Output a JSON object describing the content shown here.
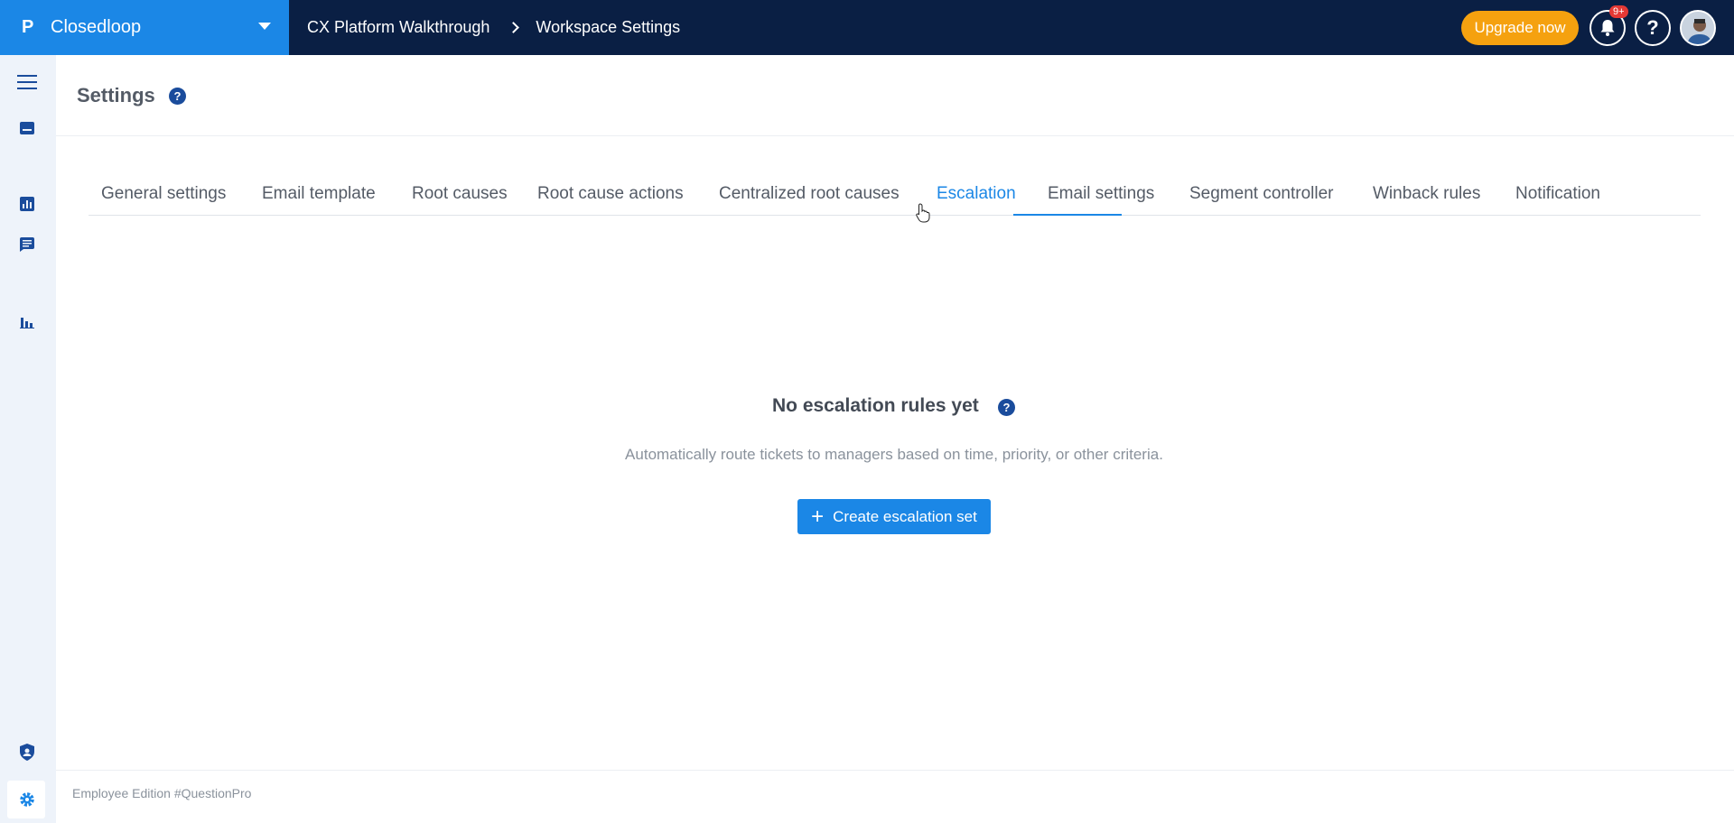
{
  "header": {
    "brand_logo": "P",
    "brand_name": "Closedloop",
    "breadcrumbs": [
      "CX Platform Walkthrough",
      "Workspace Settings"
    ],
    "upgrade_label": "Upgrade now",
    "notification_badge": "9+",
    "help_label": "?"
  },
  "sidebar": {
    "icons": [
      "menu-icon",
      "inbox-icon",
      "report-icon",
      "chat-icon",
      "bar-chart-icon",
      "admin-shield-icon",
      "settings-gear-icon"
    ]
  },
  "page": {
    "title": "Settings",
    "help": "?"
  },
  "tabs": [
    {
      "label": "General settings"
    },
    {
      "label": "Email template"
    },
    {
      "label": "Root causes"
    },
    {
      "label": "Root cause actions"
    },
    {
      "label": "Centralized root causes"
    },
    {
      "label": "Escalation",
      "active": true
    },
    {
      "label": "Email settings"
    },
    {
      "label": "Segment controller"
    },
    {
      "label": "Winback rules"
    },
    {
      "label": "Notification"
    }
  ],
  "empty_state": {
    "title": "No escalation rules yet",
    "help": "?",
    "description": "Automatically route tickets to managers based on time, priority, or other criteria.",
    "button_icon": "+",
    "button_label": "Create escalation set"
  },
  "footer": {
    "text": "Employee Edition #QuestionPro"
  },
  "colors": {
    "topbar": "#0a1f44",
    "brand": "#1b87e6",
    "accent": "#1b87e6",
    "upgrade": "#f5a10f",
    "sidebar": "#eef3fa"
  }
}
